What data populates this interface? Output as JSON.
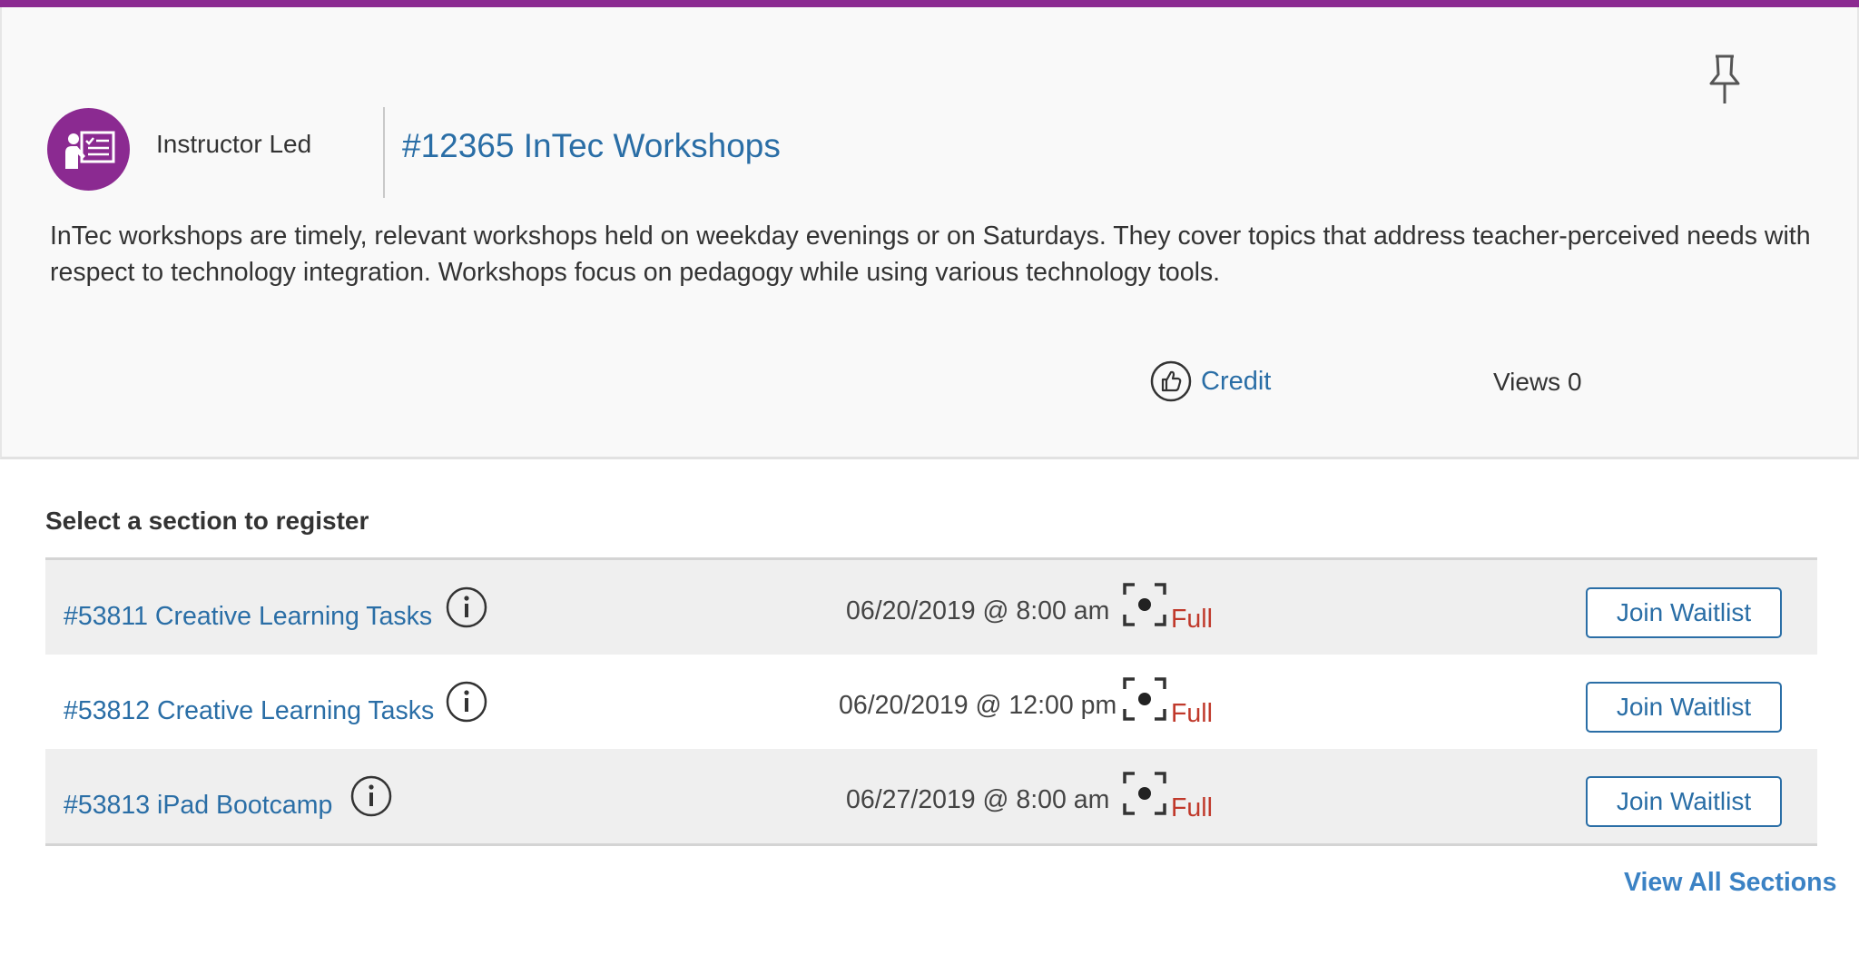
{
  "theme": {
    "accent": "#8b2a91",
    "link": "#2a6ea6",
    "status_full": "#c0392b"
  },
  "course": {
    "type_label": "Instructor Led",
    "type_icon": "instructor-presentation-icon",
    "title": "#12365 InTec Workshops",
    "description": "InTec workshops are timely, relevant workshops held on weekday evenings or on Saturdays. They cover topics that address teacher-perceived needs with respect to technology integration. Workshops focus on pedagogy while using various technology tools.",
    "credit_label": "Credit",
    "views_label": "Views 0",
    "pin_icon": "pin-icon",
    "credit_icon": "thumbs-up-icon"
  },
  "sections": {
    "heading": "Select a section to register",
    "rows": [
      {
        "title": "#53811 Creative Learning Tasks",
        "date": "06/20/2019 @ 8:00 am",
        "status": "Full",
        "button": "Join Waitlist"
      },
      {
        "title": "#53812 Creative Learning Tasks",
        "date": "06/20/2019 @ 12:00 pm",
        "status": "Full",
        "button": "Join Waitlist"
      },
      {
        "title": "#53813 iPad Bootcamp",
        "date": "06/27/2019 @ 8:00 am",
        "status": "Full",
        "button": "Join Waitlist"
      }
    ],
    "view_all": "View All Sections"
  }
}
